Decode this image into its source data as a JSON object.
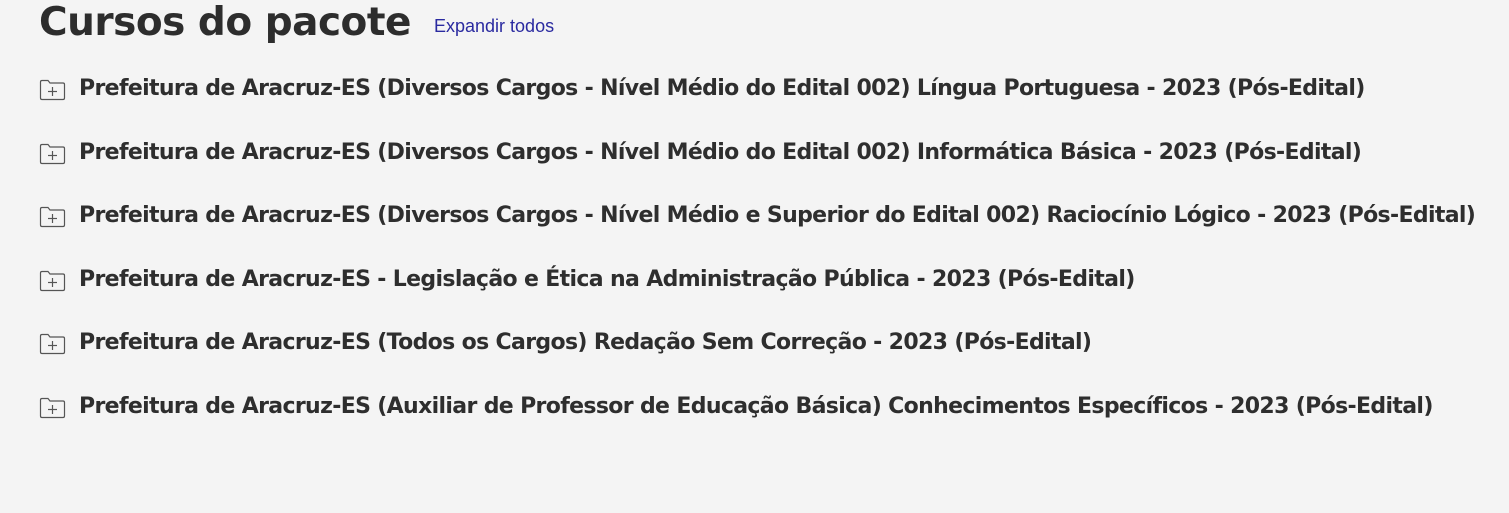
{
  "section": {
    "title": "Cursos do pacote",
    "expand_all_label": "Expandir todos"
  },
  "courses": [
    {
      "label": "Prefeitura de Aracruz-ES (Diversos Cargos - Nível Médio do Edital 002) Língua Portuguesa - 2023 (Pós-Edital)",
      "icon": "folder-plus-icon"
    },
    {
      "label": "Prefeitura de Aracruz-ES (Diversos Cargos - Nível Médio do Edital 002) Informática Básica - 2023 (Pós-Edital)",
      "icon": "folder-plus-icon"
    },
    {
      "label": "Prefeitura de Aracruz-ES (Diversos Cargos - Nível Médio e Superior do Edital 002) Raciocínio Lógico - 2023 (Pós-Edital)",
      "icon": "folder-plus-icon"
    },
    {
      "label": "Prefeitura de Aracruz-ES - Legislação e Ética na Administração Pública - 2023 (Pós-Edital)",
      "icon": "folder-plus-icon"
    },
    {
      "label": "Prefeitura de Aracruz-ES (Todos os Cargos) Redação Sem Correção - 2023 (Pós-Edital)",
      "icon": "folder-plus-icon"
    },
    {
      "label": "Prefeitura de Aracruz-ES (Auxiliar de Professor de Educação Básica) Conhecimentos Específicos - 2023 (Pós-Edital)",
      "icon": "folder-plus-icon"
    }
  ],
  "colors": {
    "background": "#f4f4f4",
    "text": "#2e2e2e",
    "link": "#2a2aa0"
  }
}
